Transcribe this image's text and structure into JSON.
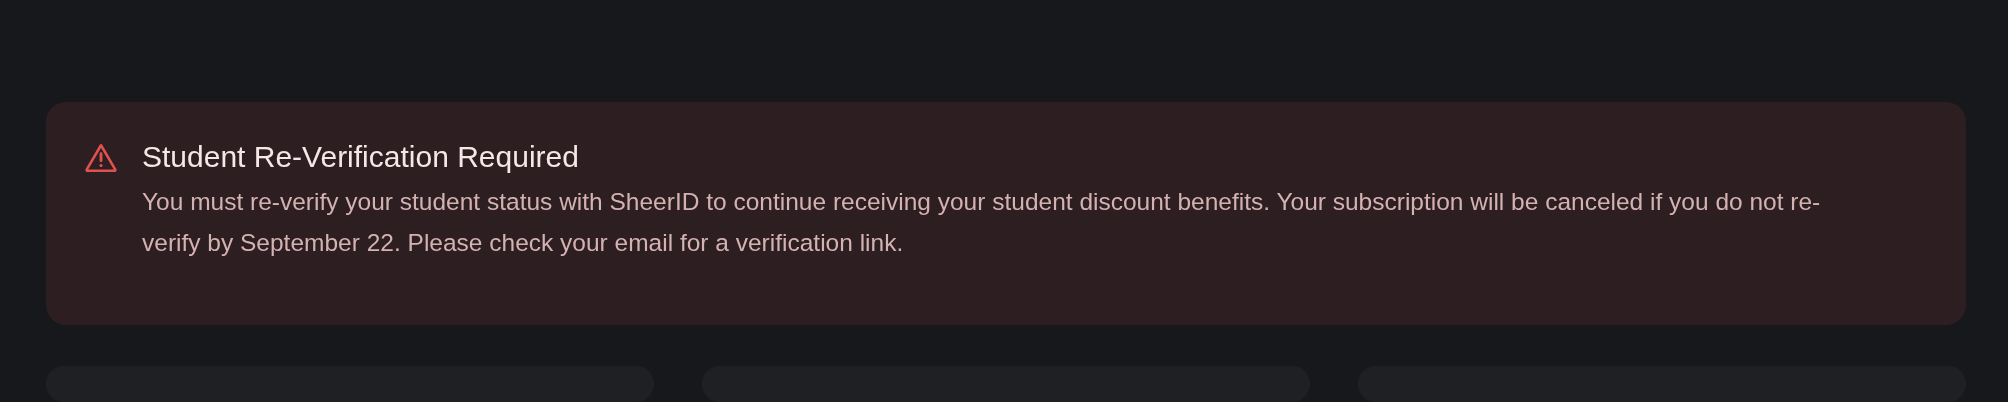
{
  "alert": {
    "title": "Student Re-Verification Required",
    "message": "You must re-verify your student status with SheerID to continue receiving your student discount benefits. Your subscription will be canceled if you do not re-verify by September 22. Please check your email for a verification link."
  },
  "cards": [
    {
      "kind": "card"
    },
    {
      "kind": "card"
    },
    {
      "kind": "card"
    }
  ]
}
